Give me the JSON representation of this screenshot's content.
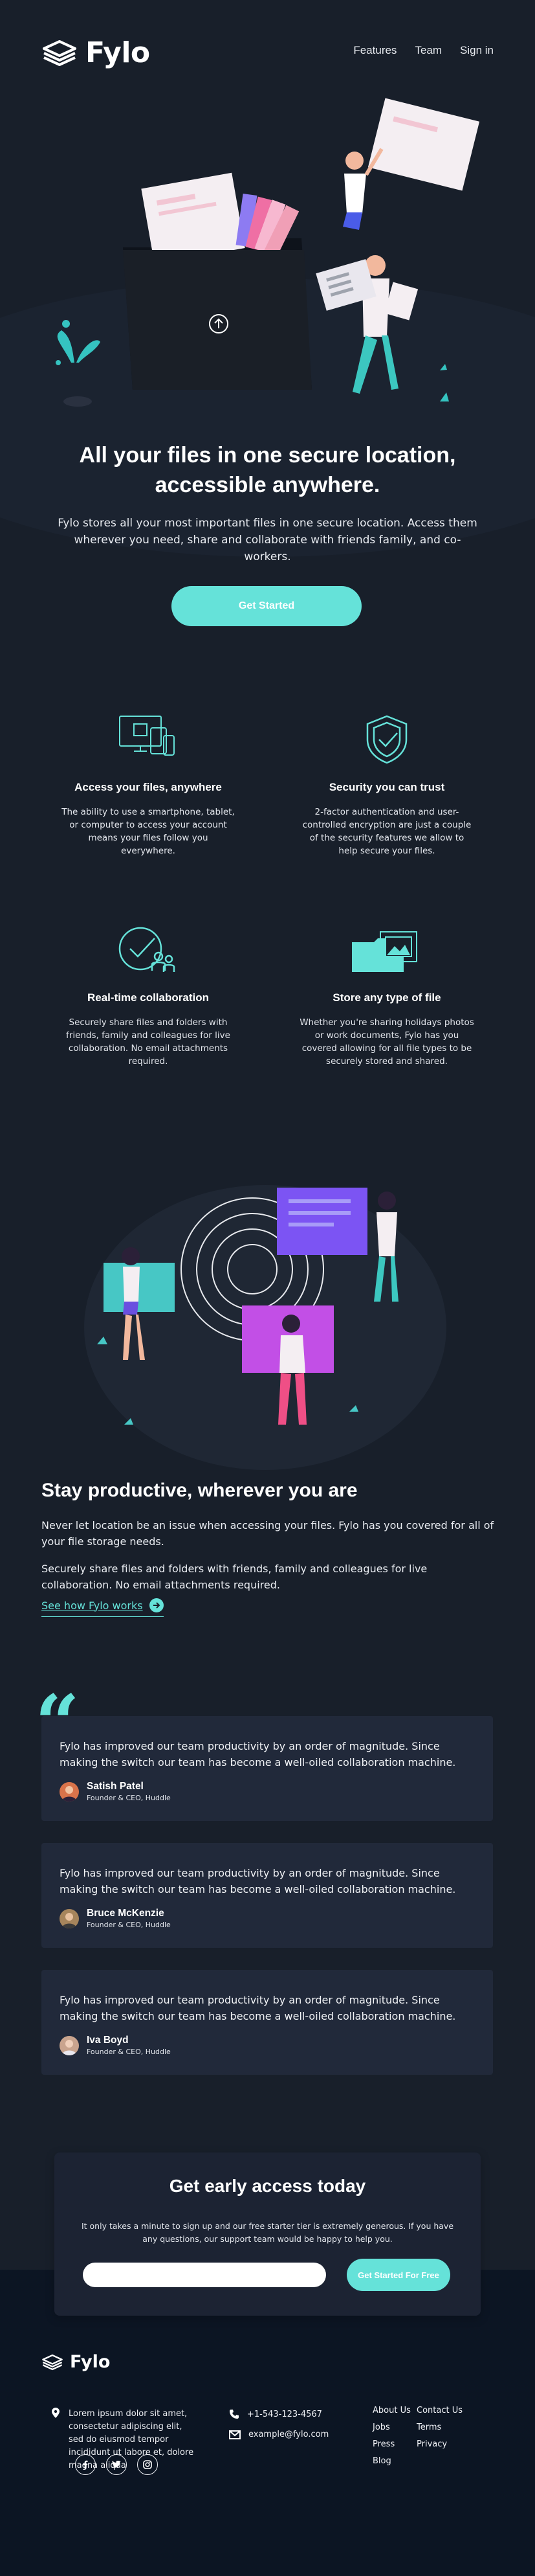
{
  "brand": {
    "name": "Fylo",
    "accent": "#65e2d9",
    "background": "#181f2a",
    "footer_background": "#0c1523"
  },
  "nav": {
    "features": "Features",
    "team": "Team",
    "signin": "Sign in"
  },
  "hero": {
    "title": "All your files in one secure location, accessible anywhere.",
    "subtitle": "Fylo stores all your most important files in one secure location. Access them wherever you need, share and collaborate with friends family, and co-workers.",
    "cta": "Get Started"
  },
  "features": [
    {
      "icon": "access-devices-icon",
      "title": "Access your files, anywhere",
      "text": "The ability to use a smartphone, tablet, or computer to access your account means your files follow you everywhere."
    },
    {
      "icon": "security-shield-icon",
      "title": "Security you can trust",
      "text": "2-factor authentication and user-controlled encryption are just a couple of the security features we allow to help secure your files."
    },
    {
      "icon": "collaboration-icon",
      "title": "Real-time collaboration",
      "text": "Securely share files and folders with friends, family and colleagues for live collaboration. No email attachments required."
    },
    {
      "icon": "file-types-icon",
      "title": "Store any type of file",
      "text": "Whether you're sharing holidays photos or work documents, Fylo has you covered allowing for all file types to be securely stored and shared."
    }
  ],
  "productive": {
    "title": "Stay productive, wherever you are",
    "p1": "Never let location be an issue when accessing your files. Fylo has you covered for all of your file storage needs.",
    "p2": "Securely share files and folders with friends, family and colleagues for live collaboration. No email attachments required.",
    "link": "See how Fylo works"
  },
  "testimonials": [
    {
      "text": "Fylo has improved our team productivity by an order of magnitude. Since making the switch our team has become a well-oiled collaboration machine.",
      "name": "Satish Patel",
      "role": "Founder & CEO, Huddle",
      "avatar_color": "#d9734a"
    },
    {
      "text": "Fylo has improved our team productivity by an order of magnitude. Since making the switch our team has become a well-oiled collaboration machine.",
      "name": "Bruce McKenzie",
      "role": "Founder & CEO, Huddle",
      "avatar_color": "#a6855c"
    },
    {
      "text": "Fylo has improved our team productivity by an order of magnitude. Since making the switch our team has become a well-oiled collaboration machine.",
      "name": "Iva Boyd",
      "role": "Founder & CEO, Huddle",
      "avatar_color": "#c9a48e"
    }
  ],
  "early_access": {
    "title": "Get early access today",
    "text": "It only takes a minute to sign up and our free starter tier is extremely generous. If you have any questions, our support team would be happy to help you.",
    "input_placeholder": "",
    "button": "Get Started For Free"
  },
  "footer": {
    "address": "Lorem ipsum dolor sit amet, consectetur adipiscing elit, sed do eiusmod tempor incididunt ut labore et, dolore magna aliqua",
    "phone": "+1-543-123-4567",
    "email": "example@fylo.com",
    "links_col1": [
      "About Us",
      "Jobs",
      "Press",
      "Blog"
    ],
    "links_col2": [
      "Contact Us",
      "Terms",
      "Privacy"
    ],
    "social": [
      "facebook-icon",
      "twitter-icon",
      "instagram-icon"
    ]
  }
}
